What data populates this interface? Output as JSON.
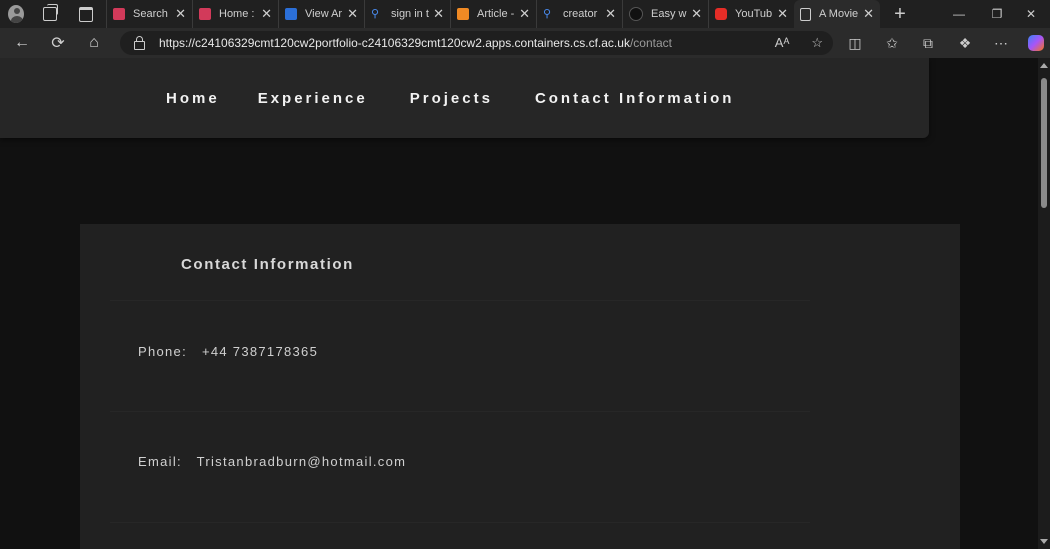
{
  "browser": {
    "tabs": [
      {
        "title": "Search",
        "favicon_color": "#d23a5a",
        "favicon": "grid-icon"
      },
      {
        "title": "Home :",
        "favicon_color": "#d23a5a",
        "favicon": "grid-icon"
      },
      {
        "title": "View Ar",
        "favicon_color": "#2b6fd8",
        "favicon": "app-icon"
      },
      {
        "title": "sign in t",
        "favicon_color": "#4a8cf0",
        "favicon": "search-icon"
      },
      {
        "title": "Article -",
        "favicon_color": "#f08a24",
        "favicon": "t-icon"
      },
      {
        "title": "creator",
        "favicon_color": "#4a8cf0",
        "favicon": "search-icon"
      },
      {
        "title": "Easy wa",
        "favicon_color": "#111111",
        "favicon": "circle-icon"
      },
      {
        "title": "YouTub",
        "favicon_color": "#e52d27",
        "favicon": "youtube-icon"
      },
      {
        "title": "A Movie",
        "favicon_color": "#2b2b2b",
        "favicon": "page-icon"
      }
    ],
    "url_host": "https://c24106329cmt120cw2portfolio-c24106329cmt120cw2.apps.containers.cs.cf.ac.uk",
    "url_path": "/contact"
  },
  "nav": {
    "links": [
      "Home",
      "Experience",
      "Projects",
      "Contact Information"
    ]
  },
  "contact": {
    "heading": "Contact Information",
    "phone_label": "Phone:",
    "phone_value": "+44 7387178365",
    "email_label": "Email:",
    "email_value": "Tristanbradburn@hotmail.com"
  }
}
